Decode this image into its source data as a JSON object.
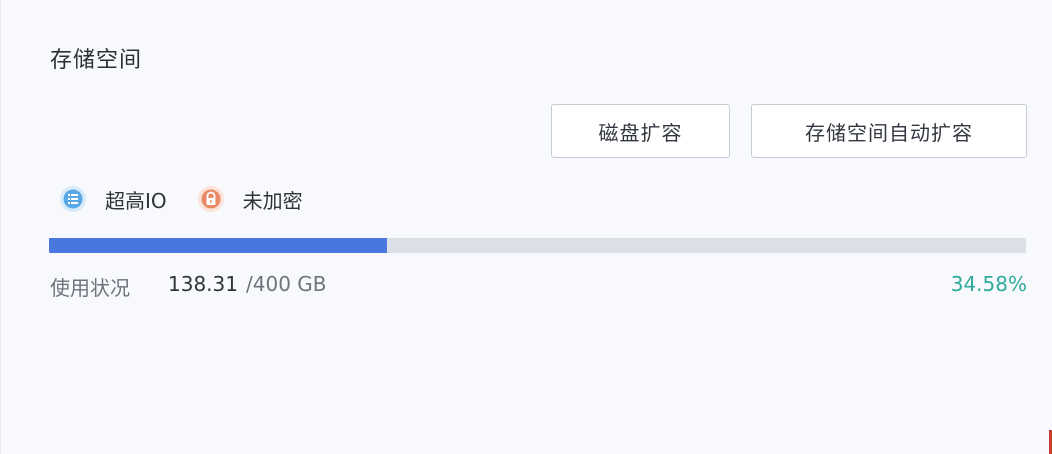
{
  "panel": {
    "title": "存储空间"
  },
  "actions": {
    "expand_label": "磁盘扩容",
    "auto_expand_label": "存储空间自动扩容"
  },
  "tags": [
    {
      "label": "超高IO",
      "icon": "list-icon",
      "color": "#5aa8e6"
    },
    {
      "label": "未加密",
      "icon": "unlock-icon",
      "color": "#e98a66"
    }
  ],
  "usage": {
    "label": "使用状况",
    "used": "138.31",
    "total": "/400 GB",
    "percent": "34.58%",
    "fraction": 0.3458,
    "bar_color": "#4a77de",
    "percent_color": "#2eaa9c"
  }
}
